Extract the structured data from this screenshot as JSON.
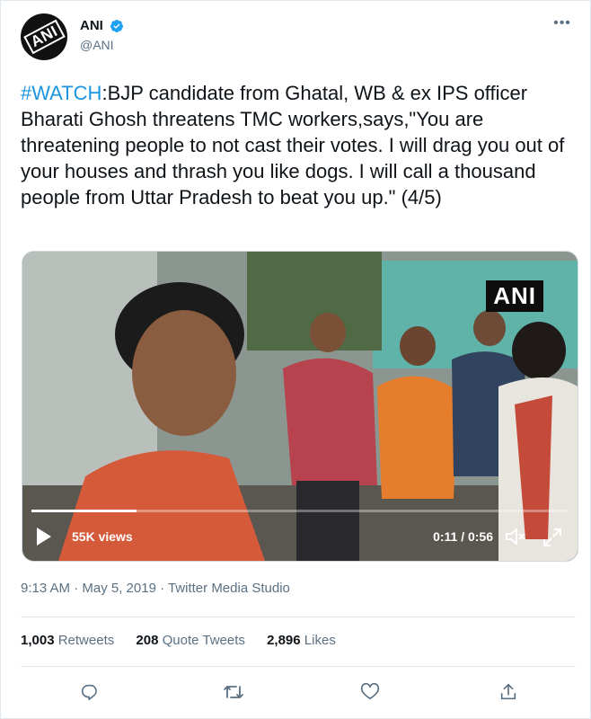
{
  "author": {
    "display_name": "ANI",
    "handle": "@ANI",
    "avatar_logo": "ANI",
    "verified_icon": "verified-badge-icon",
    "more_icon": "more-options-icon"
  },
  "tweet": {
    "hashtag": "#WATCH",
    "body": ":BJP candidate from Ghatal, WB & ex IPS officer Bharati Ghosh threatens TMC workers,says,\"You are threatening people to not cast their votes. I will drag you out of your houses and thrash you like dogs. I will call a thousand people from Uttar Pradesh to beat you up.\" (4/5)"
  },
  "video": {
    "watermark": "ANI",
    "views": "55K views",
    "time": "0:11 / 0:56",
    "progress": 0.196,
    "play_icon": "play-icon",
    "mute_icon": "muted-speaker-icon",
    "fullscreen_icon": "fullscreen-icon"
  },
  "meta": {
    "timestamp": "9:13 AM · May 5, 2019 · Twitter Media Studio"
  },
  "stats": {
    "retweets_count": "1,003",
    "retweets_label": "Retweets",
    "quotes_count": "208",
    "quotes_label": "Quote Tweets",
    "likes_count": "2,896",
    "likes_label": "Likes"
  },
  "actions": [
    "reply-icon",
    "retweet-icon",
    "like-icon",
    "share-icon"
  ],
  "colors": {
    "link": "#1b95e0",
    "secondary_text": "#5b7083",
    "primary_text": "#0f1419",
    "border": "#e1e8ed"
  }
}
